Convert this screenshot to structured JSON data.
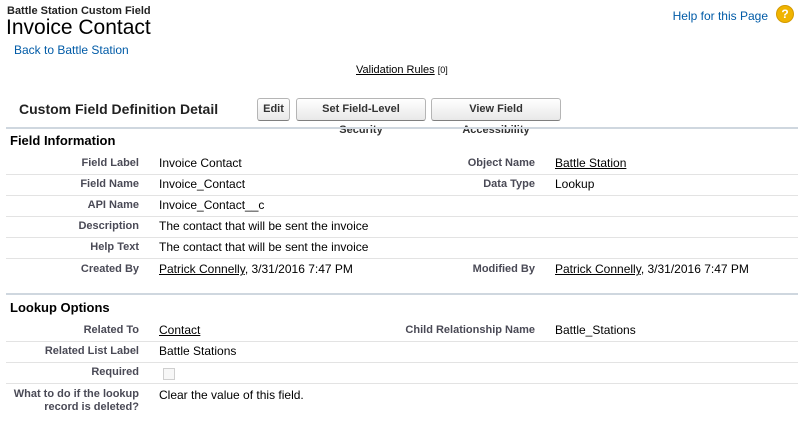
{
  "header": {
    "breadcrumb": "Battle Station Custom Field",
    "title": "Invoice Contact",
    "back_link": "Back to Battle Station",
    "help_link": "Help for this Page",
    "help_icon": "?"
  },
  "validation": {
    "label": "Validation Rules",
    "count": "[0]"
  },
  "detail": {
    "title": "Custom Field Definition Detail",
    "buttons": {
      "edit": "Edit",
      "fls": "Set Field-Level Security",
      "access": "View Field Accessibility"
    }
  },
  "field_info": {
    "title": "Field Information",
    "field_label_lbl": "Field Label",
    "field_label": "Invoice Contact",
    "object_name_lbl": "Object Name",
    "object_name": "Battle Station",
    "field_name_lbl": "Field Name",
    "field_name": "Invoice_Contact",
    "data_type_lbl": "Data Type",
    "data_type": "Lookup",
    "api_name_lbl": "API Name",
    "api_name": "Invoice_Contact__c",
    "description_lbl": "Description",
    "description": "The contact that will be sent the invoice",
    "help_text_lbl": "Help Text",
    "help_text": "The contact that will be sent the invoice",
    "created_by_lbl": "Created By",
    "created_by_name": "Patrick Connelly",
    "created_by_date": ", 3/31/2016 7:47 PM",
    "modified_by_lbl": "Modified By",
    "modified_by_name": "Patrick Connelly",
    "modified_by_date": ", 3/31/2016 7:47 PM"
  },
  "lookup": {
    "title": "Lookup Options",
    "related_to_lbl": "Related To",
    "related_to": "Contact",
    "child_rel_lbl": "Child Relationship Name",
    "child_rel": "Battle_Stations",
    "related_list_lbl": "Related List Label",
    "related_list": "Battle Stations",
    "required_lbl": "Required",
    "delete_lbl_1": "What to do if the lookup",
    "delete_lbl_2": "record is deleted?",
    "delete_val": "Clear the value of this field."
  }
}
